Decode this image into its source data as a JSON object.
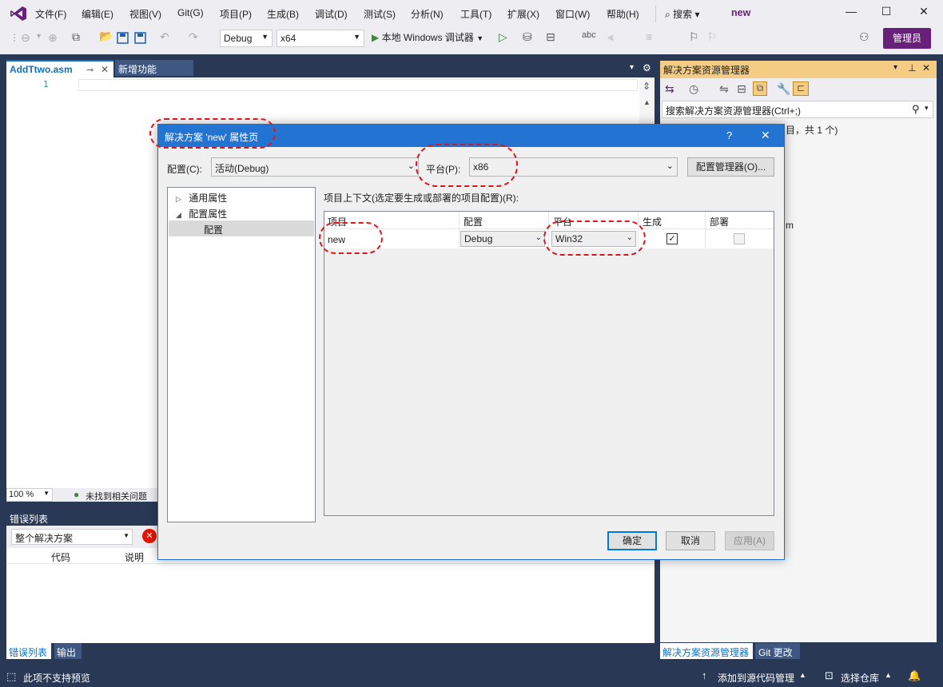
{
  "menu": {
    "items": [
      "文件(F)",
      "编辑(E)",
      "视图(V)",
      "Git(G)",
      "项目(P)",
      "生成(B)",
      "调试(D)",
      "测试(S)",
      "分析(N)",
      "工具(T)",
      "扩展(X)",
      "窗口(W)",
      "帮助(H)"
    ],
    "search_label": "搜索",
    "solution_name": "new"
  },
  "toolbar": {
    "config_value": "Debug",
    "platform_value": "x64",
    "run_label": "本地 Windows 调试器",
    "admin_label": "管理员"
  },
  "editor": {
    "tab_active": "AddTtwo.asm",
    "tab_other": "新增功能",
    "line_number": "1",
    "zoom": "100 %",
    "issues_status": "未找到相关问题"
  },
  "error_list": {
    "title": "错误列表",
    "scope": "整个解决方案",
    "col_code": "代码",
    "col_desc": "说明",
    "tab_errors": "错误列表",
    "tab_output": "输出"
  },
  "solution_explorer": {
    "title": "解决方案资源管理器",
    "search_placeholder": "搜索解决方案资源管理器(Ctrl+;)",
    "partial_line": "目，共 1 个)",
    "partial_item": "m",
    "tab_se": "解决方案资源管理器",
    "tab_git": "Git 更改"
  },
  "status_bar": {
    "preview": "此项不支持预览",
    "add_source": "添加到源代码管理",
    "select_repo": "选择仓库"
  },
  "dialog": {
    "title": "解决方案 'new' 属性页",
    "help": "?",
    "config_label": "配置(C):",
    "config_value": "活动(Debug)",
    "platform_label": "平台(P):",
    "platform_value": "x86",
    "config_manager": "配置管理器(O)...",
    "tree": {
      "general": "通用属性",
      "config_props": "配置属性",
      "config": "配置"
    },
    "context_label": "项目上下文(选定要生成或部署的项目配置)(R):",
    "grid": {
      "headers": [
        "项目",
        "配置",
        "平台",
        "生成",
        "部署"
      ],
      "row": {
        "project": "new",
        "configuration": "Debug",
        "platform": "Win32",
        "build_checked": true,
        "deploy_checked": false
      }
    },
    "ok": "确定",
    "cancel": "取消",
    "apply": "应用(A)"
  },
  "colors": {
    "accent": "#68217a",
    "title_blue": "#2374d2",
    "ide_bg": "#293955",
    "annotation": "#e0141e"
  }
}
